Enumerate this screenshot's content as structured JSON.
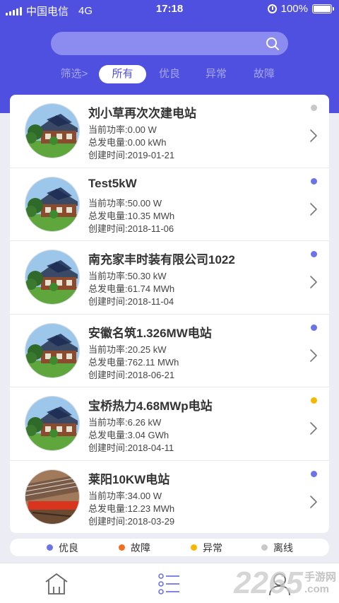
{
  "status_bar": {
    "carrier": "中国电信",
    "network": "4G",
    "time": "17:18",
    "battery": "100%",
    "battery_level": 1.0
  },
  "search": {
    "value": "",
    "placeholder": "",
    "icon": "search-icon"
  },
  "filters": {
    "filter_label": "筛选>",
    "tabs": [
      {
        "label": "所有",
        "active": true
      },
      {
        "label": "优良",
        "active": false
      },
      {
        "label": "异常",
        "active": false
      },
      {
        "label": "故障",
        "active": false
      }
    ]
  },
  "stations": [
    {
      "name": "刘小草再次次建电站",
      "power": "当前功率:0.00 W",
      "energy": "总发电量:0.00 kWh",
      "created": "创建时间:2019-01-21",
      "status": "offline",
      "status_color": "#c8c8c8",
      "photo": "house"
    },
    {
      "name": "Test5kW",
      "power": "当前功率:50.00 W",
      "energy": "总发电量:10.35 MWh",
      "created": "创建时间:2018-11-06",
      "status": "good",
      "status_color": "#6b74e6",
      "photo": "house"
    },
    {
      "name": "南充家丰时装有限公司1022",
      "power": "当前功率:50.30 kW",
      "energy": "总发电量:61.74 MWh",
      "created": "创建时间:2018-11-04",
      "status": "good",
      "status_color": "#6b74e6",
      "photo": "house"
    },
    {
      "name": "安徽名筑1.326MW电站",
      "power": "当前功率:20.25 kW",
      "energy": "总发电量:762.11 MWh",
      "created": "创建时间:2018-06-21",
      "status": "good",
      "status_color": "#6b74e6",
      "photo": "house"
    },
    {
      "name": "宝桥热力4.68MWp电站",
      "power": "当前功率:6.26 kW",
      "energy": "总发电量:3.04 GWh",
      "created": "创建时间:2018-04-11",
      "status": "abnormal",
      "status_color": "#f5b800",
      "photo": "house"
    },
    {
      "name": "莱阳10KW电站",
      "power": "当前功率:34.00 W",
      "energy": "总发电量:12.23 MWh",
      "created": "创建时间:2018-03-29",
      "status": "good",
      "status_color": "#6b74e6",
      "photo": "panels"
    }
  ],
  "legend": [
    {
      "label": "优良",
      "color": "#6b74e6"
    },
    {
      "label": "故障",
      "color": "#f07020"
    },
    {
      "label": "异常",
      "color": "#f5b800"
    },
    {
      "label": "离线",
      "color": "#c8c8c8"
    }
  ],
  "tabbar": [
    {
      "icon": "home-icon"
    },
    {
      "icon": "list-icon",
      "active": true
    },
    {
      "icon": "profile-icon"
    }
  ],
  "watermark": {
    "number": "2265",
    "suffix": "手游网",
    "domain": ".com"
  },
  "colors": {
    "primary": "#4f4fe0",
    "search_bg": "#8c8cf0",
    "filter_inactive": "#a7a7f3"
  }
}
